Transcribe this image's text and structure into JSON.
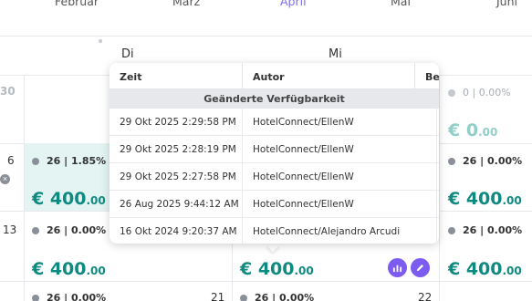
{
  "months": [
    "Februar",
    "März",
    "April",
    "Mai",
    "Juni"
  ],
  "active_month": "April",
  "weekdays": {
    "di": "Di",
    "mi": "Mi"
  },
  "day_numbers": {
    "d30": "30",
    "d6": "6",
    "d13": "13",
    "d21": "21",
    "d22": "22"
  },
  "cells": {
    "col1_row2_stat": "26 | 1.85%",
    "col1_row3_stat": "26 | 0.00%",
    "col1_row4_stat": "26 | 0.00%",
    "col2_row4_stat": "26 | 0.00%",
    "col3_row1_stat": "0 | 0.00%",
    "col3_row2_stat": "26 | 0.00%",
    "col3_row3_stat": "26 | 0.00%",
    "price_major": "€ 400",
    "price_minor": ".00",
    "zero_major": "€ 0",
    "zero_minor": ".00"
  },
  "popover": {
    "headers": {
      "zeit": "Zeit",
      "autor": "Autor",
      "be": "Be"
    },
    "group_label": "Geänderte Verfügbarkeit",
    "rows": [
      {
        "time": "29 Okt 2025 2:29:58 PM",
        "author": "HotelConnect/EllenW"
      },
      {
        "time": "29 Okt 2025 2:28:19 PM",
        "author": "HotelConnect/EllenW"
      },
      {
        "time": "29 Okt 2025 2:27:58 PM",
        "author": "HotelConnect/EllenW"
      },
      {
        "time": "26 Aug 2025 9:44:12 AM",
        "author": "HotelConnect/EllenW"
      },
      {
        "time": "16 Okt 2024 9:20:37 AM",
        "author": "HotelConnect/Alejandro Arcudi"
      }
    ]
  },
  "icons": {
    "chart": "bar-chart-icon",
    "edit": "pencil-icon",
    "remove": "close-icon"
  },
  "colors": {
    "accent": "#7c5cf0",
    "price": "#0f8a80",
    "highlight": "#e3f4f3"
  }
}
